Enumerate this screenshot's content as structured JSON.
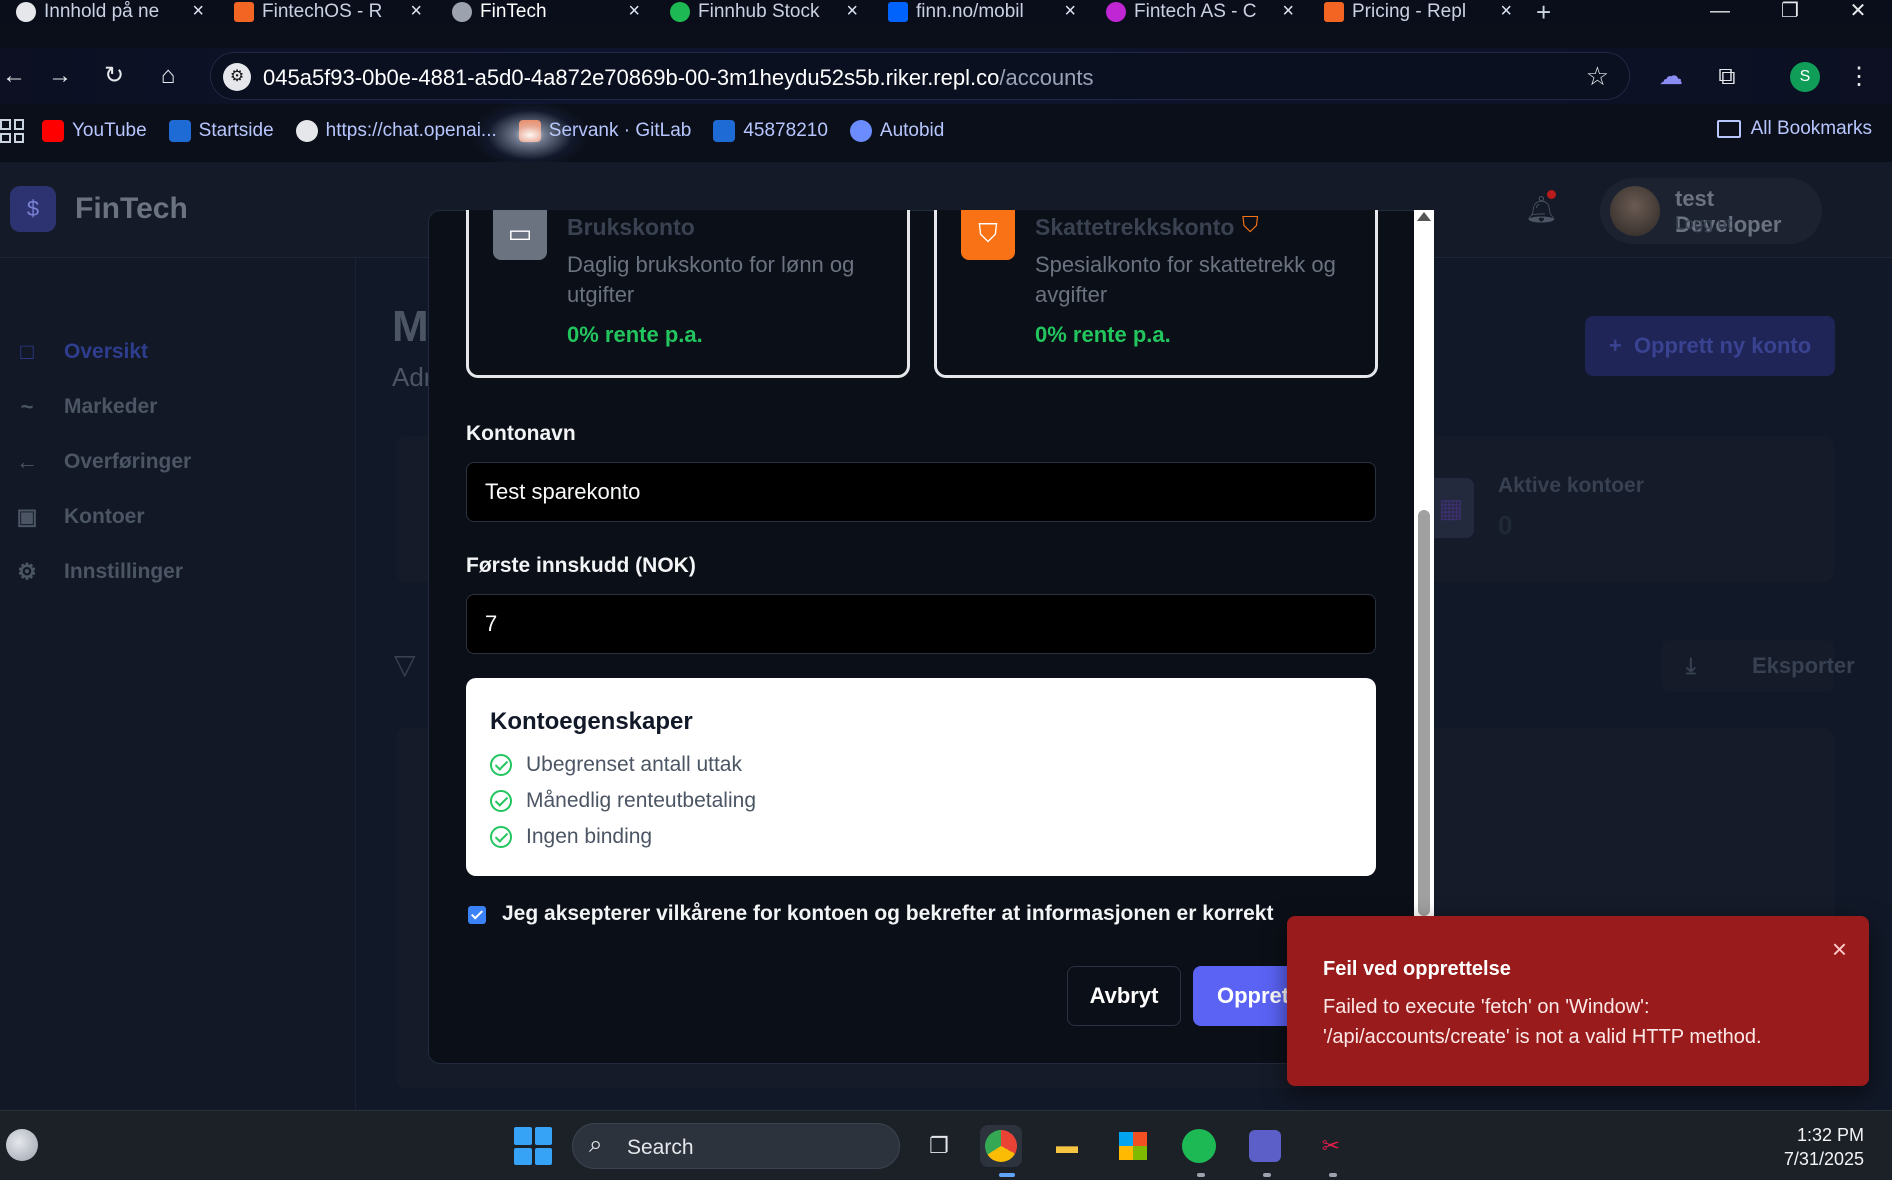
{
  "browser": {
    "tabs": [
      {
        "label": "Innhold på ne",
        "icon_color": "#e5e7eb",
        "active": false
      },
      {
        "label": "FintechOS - R",
        "icon_color": "#f26522",
        "active": false
      },
      {
        "label": "FinTech",
        "icon_color": "#9ca3af",
        "active": true
      },
      {
        "label": "Finnhub Stock",
        "icon_color": "#1db954",
        "active": false
      },
      {
        "label": "finn.no/mobil",
        "icon_color": "#0063fb",
        "active": false
      },
      {
        "label": "Fintech AS - C",
        "icon_color": "#c026d3",
        "active": false
      },
      {
        "label": "Pricing - Repl",
        "icon_color": "#f26522",
        "active": false
      }
    ],
    "new_tab": "+",
    "url_host": "045a5f93-0b0e-4881-a5d0-4a872e70869b-00-3m1heydu52s5b.riker.repl.co",
    "url_path": "/accounts",
    "bookmarks": [
      {
        "label": "YouTube",
        "icon_color": "#ff0000"
      },
      {
        "label": "Startside",
        "icon_color": "#1e6bd6"
      },
      {
        "label": "https://chat.openai...",
        "icon_color": "#e5e7eb"
      },
      {
        "label": "Servank · GitLab",
        "icon_color": "#fc6d26"
      },
      {
        "label": "45878210",
        "icon_color": "#1e6bd6"
      },
      {
        "label": "Autobid",
        "icon_color": "#6b8cff"
      }
    ],
    "all_bookmarks": "All Bookmarks",
    "profile_initial": "S"
  },
  "app": {
    "brand": "FinTech",
    "logo_symbol": "$",
    "user_name": "test Developer",
    "logout": "Logg ut",
    "sidebar": [
      {
        "label": "Oversikt",
        "icon": "□",
        "active": true
      },
      {
        "label": "Markeder",
        "icon": "~",
        "active": false
      },
      {
        "label": "Overføringer",
        "icon": "←",
        "active": false
      },
      {
        "label": "Kontoer",
        "icon": "▣",
        "active": false
      },
      {
        "label": "Innstillinger",
        "icon": "⚙",
        "active": false
      }
    ],
    "page_title": "M",
    "page_subtitle": "Adr",
    "create_button": "Opprett ny konto",
    "create_button_icon": "+",
    "stat_label": "Aktive kontoer",
    "stat_value": "0",
    "export_button": "Eksporter"
  },
  "modal": {
    "account_types": [
      {
        "name": "Brukskonto",
        "description": "Daglig brukskonto for lønn og utgifter",
        "rate": "0% rente p.a.",
        "icon_color": "#6b7280",
        "icon": "▭"
      },
      {
        "name": "Skattetrekkskonto",
        "description": "Spesialkonto for skattetrekk og avgifter",
        "rate": "0% rente p.a.",
        "icon_color": "#f97316",
        "icon": "⛉"
      }
    ],
    "account_name_label": "Kontonavn",
    "account_name_value": "Test sparekonto",
    "deposit_label": "Første innskudd (NOK)",
    "deposit_value": "7",
    "properties_title": "Kontoegenskaper",
    "properties": [
      "Ubegrenset antall uttak",
      "Månedlig renteutbetaling",
      "Ingen binding"
    ],
    "terms_text": "Jeg aksepterer vilkårene for kontoen og bekrefter at informasjonen er korrekt",
    "terms_checked": true,
    "cancel_button": "Avbryt",
    "submit_button": "Opprett"
  },
  "toast": {
    "title": "Feil ved opprettelse",
    "message": "Failed to execute 'fetch' on 'Window': '/api/accounts/create' is not a valid HTTP method.",
    "close": "×"
  },
  "taskbar": {
    "search_label": "Search",
    "time": "1:32 PM",
    "date": "7/31/2025"
  }
}
